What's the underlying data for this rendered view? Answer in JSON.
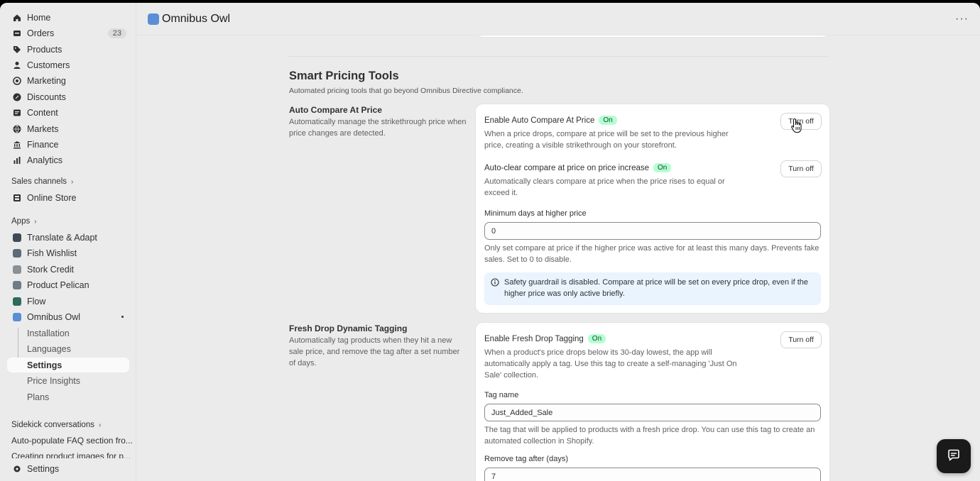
{
  "sidebar": {
    "nav": [
      {
        "label": "Home",
        "icon": "home-icon"
      },
      {
        "label": "Orders",
        "icon": "orders-icon",
        "badge": "23"
      },
      {
        "label": "Products",
        "icon": "tag-icon"
      },
      {
        "label": "Customers",
        "icon": "person-icon"
      },
      {
        "label": "Marketing",
        "icon": "target-icon"
      },
      {
        "label": "Discounts",
        "icon": "discount-icon"
      },
      {
        "label": "Content",
        "icon": "content-icon"
      },
      {
        "label": "Markets",
        "icon": "globe-icon"
      },
      {
        "label": "Finance",
        "icon": "bank-icon"
      },
      {
        "label": "Analytics",
        "icon": "chart-icon"
      }
    ],
    "sales_channels_label": "Sales channels",
    "online_store_label": "Online Store",
    "apps_label": "Apps",
    "apps": [
      {
        "label": "Translate & Adapt",
        "color": "#3f4a56"
      },
      {
        "label": "Fish Wishlist",
        "color": "#5d6b78"
      },
      {
        "label": "Stork Credit",
        "color": "#8a9097"
      },
      {
        "label": "Product Pelican",
        "color": "#6f7b86"
      },
      {
        "label": "Flow",
        "color": "#2f6b5a"
      },
      {
        "label": "Omnibus Owl",
        "color": "#5a8fd6"
      }
    ],
    "omnibus_sub": [
      "Installation",
      "Languages",
      "Settings",
      "Price Insights",
      "Plans"
    ],
    "sidekick_label": "Sidekick conversations",
    "sidekick_items": [
      "Auto-populate FAQ section fro...",
      "Creating product images for p..."
    ],
    "settings_label": "Settings"
  },
  "header": {
    "title": "Omnibus Owl",
    "more_icon": "ellipsis-icon"
  },
  "page": {
    "heading": "Smart Pricing Tools",
    "subheading": "Automated pricing tools that go beyond Omnibus Directive compliance.",
    "auto_compare": {
      "title": "Auto Compare At Price",
      "desc": "Automatically manage the strikethrough price when price changes are detected.",
      "enable_label": "Enable Auto Compare At Price",
      "enable_status": "On",
      "enable_desc": "When a price drops, compare at price will be set to the previous higher price, creating a visible strikethrough on your storefront.",
      "enable_button": "Turn off",
      "autoclear_label": "Auto-clear compare at price on price increase",
      "autoclear_status": "On",
      "autoclear_desc": "Automatically clears compare at price when the price rises to equal or exceed it.",
      "autoclear_button": "Turn off",
      "min_days_label": "Minimum days at higher price",
      "min_days_value": "0",
      "min_days_help": "Only set compare at price if the higher price was active for at least this many days. Prevents fake sales. Set to 0 to disable.",
      "banner_text": "Safety guardrail is disabled. Compare at price will be set on every price drop, even if the higher price was only active briefly."
    },
    "fresh_drop": {
      "title": "Fresh Drop Dynamic Tagging",
      "desc": "Automatically tag products when they hit a new sale price, and remove the tag after a set number of days.",
      "enable_label": "Enable Fresh Drop Tagging",
      "enable_status": "On",
      "enable_desc": "When a product's price drops below its 30-day lowest, the app will automatically apply a tag. Use this tag to create a self-managing 'Just On Sale' collection.",
      "enable_button": "Turn off",
      "tag_name_label": "Tag name",
      "tag_name_value": "Just_Added_Sale",
      "tag_name_help": "The tag that will be applied to products with a fresh price drop. You can use this tag to create an automated collection in Shopify.",
      "remove_label": "Remove tag after (days)",
      "remove_value": "7"
    }
  },
  "colors": {
    "on_pill_bg": "#b4fed2",
    "on_pill_text": "#0c5132",
    "banner_bg": "#eaf4ff"
  }
}
